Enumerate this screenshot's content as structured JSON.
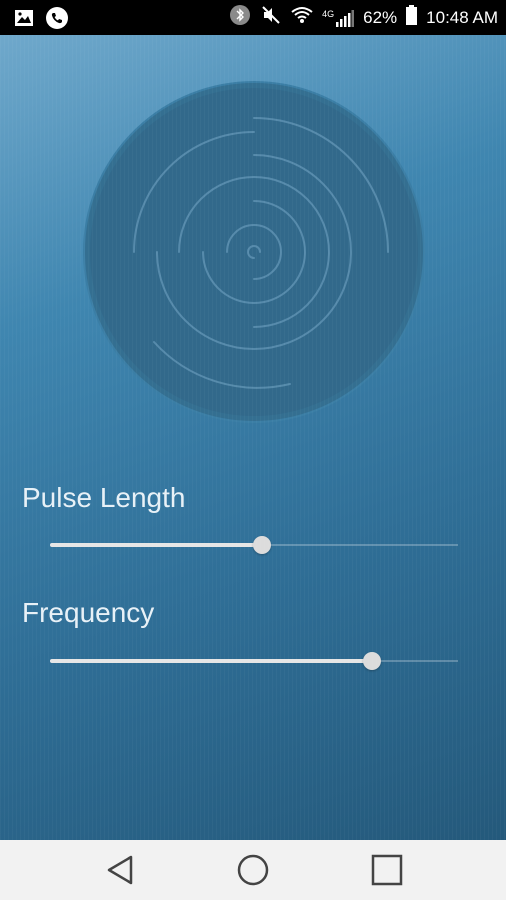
{
  "status_bar": {
    "battery_percent": "62%",
    "time": "10:48 AM",
    "network_label": "4G",
    "icons": [
      "gallery-icon",
      "phone-icon",
      "bluetooth-icon",
      "mute-icon",
      "wifi-icon",
      "signal-icon",
      "battery-icon"
    ]
  },
  "controls": {
    "pulse_length": {
      "label": "Pulse Length",
      "value_fraction": 0.52
    },
    "frequency": {
      "label": "Frequency",
      "value_fraction": 0.79
    }
  },
  "colors": {
    "background_top": "#6fa8cb",
    "background_bottom": "#24597b",
    "slider_fill": "#e6e6e6"
  },
  "nav_bar": {
    "icons": [
      "back-icon",
      "home-icon",
      "recents-icon"
    ]
  }
}
